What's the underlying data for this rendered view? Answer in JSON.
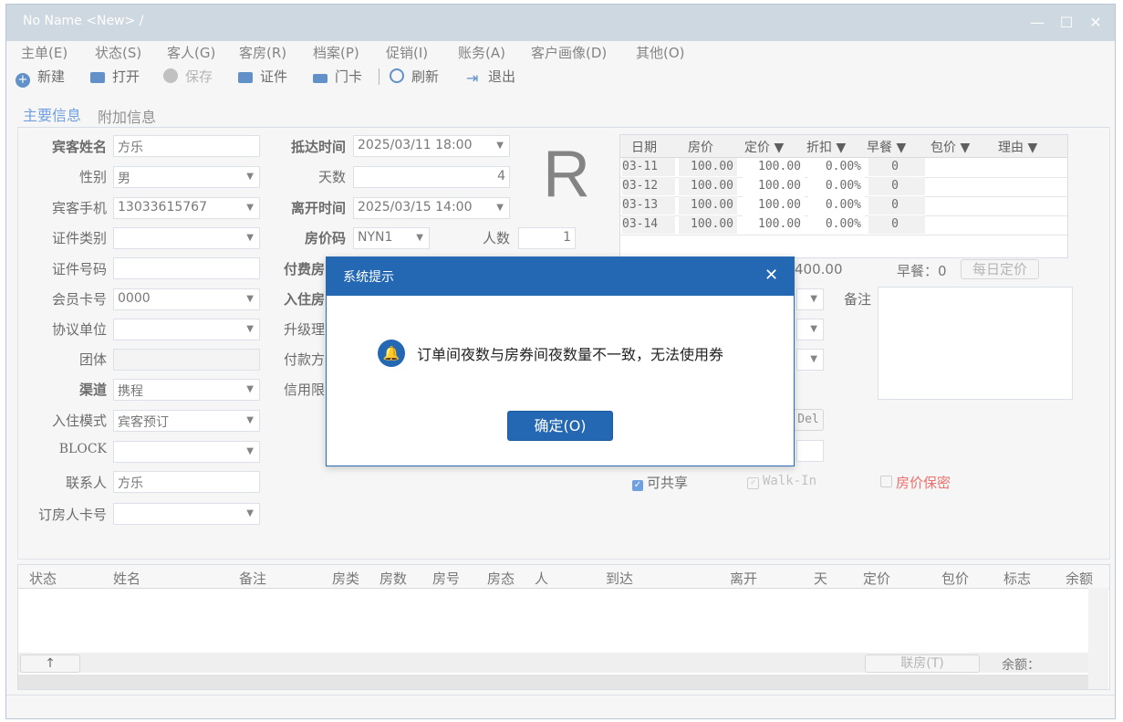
{
  "window": {
    "title": "No Name <New> /"
  },
  "menu": [
    "主单(E)",
    "状态(S)",
    "客人(G)",
    "客房(R)",
    "档案(P)",
    "促销(I)",
    "账务(A)",
    "客户画像(D)",
    "其他(O)"
  ],
  "toolbar": {
    "new": "新建",
    "open": "打开",
    "save": "保存",
    "cert": "证件",
    "card": "门卡",
    "refresh": "刷新",
    "exit": "退出"
  },
  "tabs": {
    "main": "主要信息",
    "extra": "附加信息"
  },
  "form": {
    "guest_name_label": "宾客姓名",
    "guest_name": "方乐",
    "gender_label": "性别",
    "gender": "男",
    "phone_label": "宾客手机",
    "phone": "13033615767",
    "id_type_label": "证件类别",
    "id_type": "",
    "id_no_label": "证件号码",
    "id_no": "",
    "member_label": "会员卡号",
    "member": "0000",
    "agreement_label": "协议单位",
    "agreement": "",
    "group_label": "团体",
    "group": "",
    "channel_label": "渠道",
    "channel": "携程",
    "checkin_mode_label": "入住模式",
    "checkin_mode": "宾客预订",
    "block_label": "BLOCK",
    "block": "",
    "contact_label": "联系人",
    "contact": "方乐",
    "booker_card_label": "订房人卡号",
    "booker_card": "",
    "arrive_label": "抵达时间",
    "arrive": "2025/03/11 18:00",
    "days_label": "天数",
    "days": "4",
    "depart_label": "离开时间",
    "depart": "2025/03/15 14:00",
    "rate_code_label": "房价码",
    "rate_code": "NYN1",
    "persons_label": "人数",
    "persons": "1",
    "pay_room_label": "付费房",
    "checkin_room_label": "入住房",
    "upgrade_label": "升级理",
    "pay_method_label": "付款方",
    "credit_label": "信用限",
    "room_type_big": "R",
    "remark_label": "备注",
    "shareable": "可共享",
    "walkin": "Walk-In",
    "rate_secret": "房价保密",
    "del_btn": "Del"
  },
  "rate_grid": {
    "headers": [
      "日期",
      "房价",
      "定价 ▼",
      "折扣 ▼",
      "早餐 ▼",
      "包价 ▼",
      "理由 ▼"
    ],
    "rows": [
      [
        "03-11",
        "100.00",
        "100.00",
        "0.00%",
        "0"
      ],
      [
        "03-12",
        "100.00",
        "100.00",
        "0.00%",
        "0"
      ],
      [
        "03-13",
        "100.00",
        "100.00",
        "0.00%",
        "0"
      ],
      [
        "03-14",
        "100.00",
        "100.00",
        "0.00%",
        "0"
      ]
    ],
    "total": "400.00",
    "breakfast": "早餐：0",
    "daily_btn": "每日定价"
  },
  "lower_grid": {
    "headers": [
      "状态",
      "姓名",
      "备注",
      "房类",
      "房数",
      "房号",
      "房态",
      "人",
      "到达",
      "离开",
      "天",
      "定价",
      "包价",
      "标志",
      "余额"
    ],
    "up_btn": "↑",
    "link_btn": "联房(T)",
    "balance": "余额："
  },
  "dialog": {
    "title": "系统提示",
    "message": "订单间夜数与房券间夜数量不一致，无法使用券",
    "ok": "确定(O)"
  },
  "colors": {
    "accent": "#2467b3",
    "tab_active": "#3a7bd5",
    "warning": "#e53935"
  }
}
